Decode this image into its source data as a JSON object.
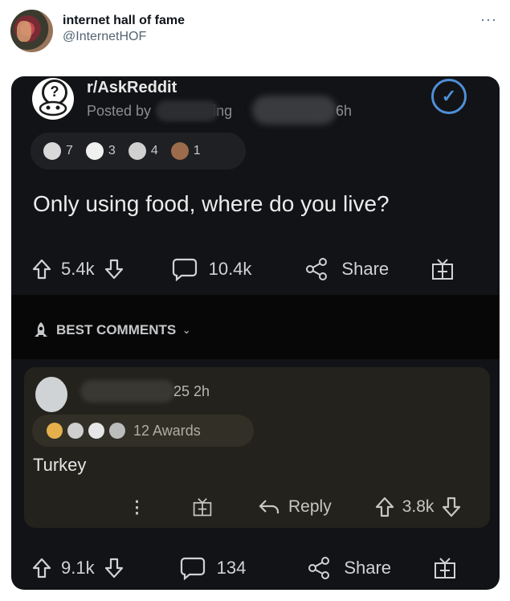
{
  "tweet": {
    "display_name": "internet hall of fame",
    "handle": "@InternetHOF",
    "more_icon": "more-dots-icon"
  },
  "post": {
    "subreddit": "r/AskReddit",
    "posted_by_prefix": "Posted by",
    "posted_by_fragment": "fucking",
    "age": "6h",
    "title": "Only using food, where do you live?",
    "awards": [
      {
        "icon": "award-icon",
        "count": "7"
      },
      {
        "icon": "award-icon",
        "count": "3"
      },
      {
        "icon": "award-icon",
        "count": "4"
      },
      {
        "icon": "award-icon",
        "count": "1"
      }
    ],
    "upvotes": "5.4k",
    "comments": "10.4k",
    "share_label": "Share"
  },
  "best_comments_label": "BEST COMMENTS",
  "comment": {
    "score_time": "25 2h",
    "awards_label": "12 Awards",
    "body": "Turkey",
    "reply_label": "Reply",
    "votes": "3.8k",
    "more_label": "⋮"
  },
  "bottom_bar": {
    "votes": "9.1k",
    "comments": "134",
    "share_label": "Share"
  }
}
